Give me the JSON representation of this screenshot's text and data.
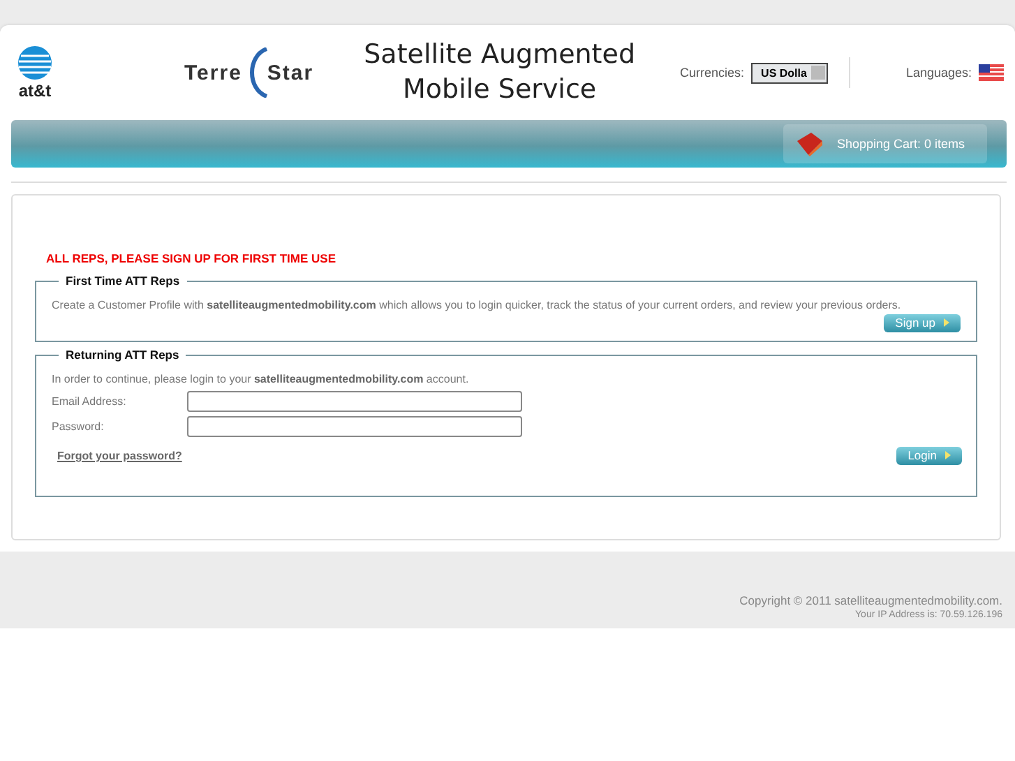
{
  "header": {
    "att_logo": "at&t",
    "terrestar_logo": [
      "Terre",
      "Star"
    ],
    "title": [
      "Satellite Augmented",
      "Mobile Service"
    ],
    "currencies_label": "Currencies:",
    "currency_value": "US Dolla",
    "languages_label": "Languages:"
  },
  "nav": {
    "cart": "Shopping Cart:  0 items"
  },
  "notice": "ALL REPS, PLEASE SIGN UP FOR FIRST TIME USE",
  "first_time": {
    "legend": "First Time ATT Reps",
    "text": "Create a Customer Profile with **satelliteaugmentedmobility.com** which allows you to login quicker, track the status of your current orders, and review your previous orders.",
    "button": "Sign up"
  },
  "returning": {
    "legend": "Returning ATT Reps",
    "text": "In order to continue, please login to your **satelliteaugmentedmobility.com** account.",
    "fields": [
      {
        "label": "Email Address:"
      },
      {
        "label": "Password:"
      }
    ],
    "forgot_link": "Forgot your password?",
    "button": "Login"
  },
  "footer": {
    "copyright": "Copyright © 2011 satelliteaugmentedmobility.com.",
    "ip": "Your IP Address is: 70.59.126.196"
  }
}
